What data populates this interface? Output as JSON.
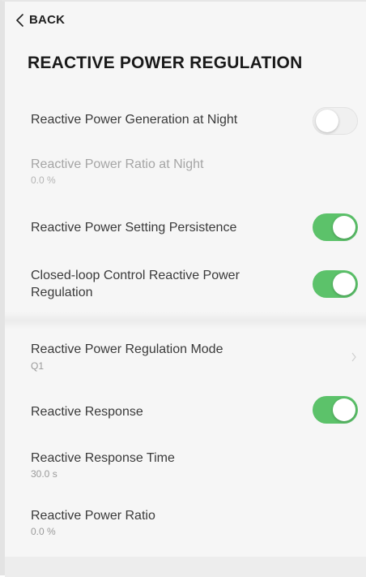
{
  "nav": {
    "back_label": "BACK"
  },
  "page": {
    "title": "REACTIVE POWER REGULATION"
  },
  "settings": [
    {
      "label": "Reactive Power Generation at Night",
      "toggle": "off"
    },
    {
      "label": "Reactive Power Ratio at Night",
      "value": "0.0 %"
    },
    {
      "label": "Reactive Power Setting Persistence",
      "toggle": "on"
    },
    {
      "label_line1": "Closed-loop Control Reactive Power",
      "label_line2": "Regulation",
      "toggle": "on"
    },
    {
      "label": "Reactive Power Regulation Mode",
      "value": "Q1"
    },
    {
      "label": "Reactive Response",
      "toggle": "on"
    },
    {
      "label": "Reactive Response Time",
      "value": "30.0 s"
    },
    {
      "label": "Reactive Power Ratio",
      "value": "0.0 %"
    }
  ],
  "colors": {
    "toggle_on": "#5cc26a",
    "toggle_off": "#f0f0f0",
    "background": "#f6f6f6"
  },
  "icons": {
    "back": "chevron-left-icon",
    "mode_arrow": "chevron-right-icon"
  }
}
